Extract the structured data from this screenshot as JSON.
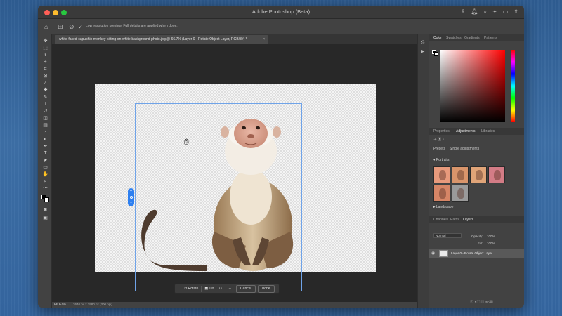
{
  "app": {
    "title": "Adobe Photoshop (Beta)"
  },
  "options_bar": {
    "message": "Low resolution preview. Full details are applied when done."
  },
  "document": {
    "tab_title": "white-faced-capuchin-monkey-sitting-on-white-background-photo.jpg @ 66.7% (Layer 0 - Rotate Object Layer, RGB/8#) *",
    "close_glyph": "×"
  },
  "context_bar": {
    "rotate": "Rotate",
    "tilt": "Tilt",
    "more": "···",
    "cancel": "Cancel",
    "done": "Done"
  },
  "status": {
    "zoom": "66.67%",
    "doc_info": "2640 px x 1980 px (300 ppi)"
  },
  "panels": {
    "color_tabs": [
      "Color",
      "Swatches",
      "Gradients",
      "Patterns"
    ],
    "adjust_tabs": [
      "Properties",
      "Adjustments",
      "Libraries"
    ],
    "adjust_sub": [
      "Presets",
      "Single adjustments"
    ],
    "portraits_label": "Portraits",
    "landscape_label": "Landscape",
    "layers_tabs": [
      "Channels",
      "Paths",
      "Layers"
    ],
    "blend_mode": "Normal",
    "opacity_label": "Opacity:",
    "opacity_value": "100%",
    "fill_label": "Fill:",
    "fill_value": "100%",
    "layer_name": "Layer 0 - Rotate Object Layer"
  },
  "colors": {
    "accent_blue": "#2d7ff0",
    "foreground": "#000000",
    "background": "#ffffff"
  },
  "icons": {
    "hand_cursor": "hand-cursor-icon",
    "rotate_handle": "rotate-handle-icon"
  }
}
